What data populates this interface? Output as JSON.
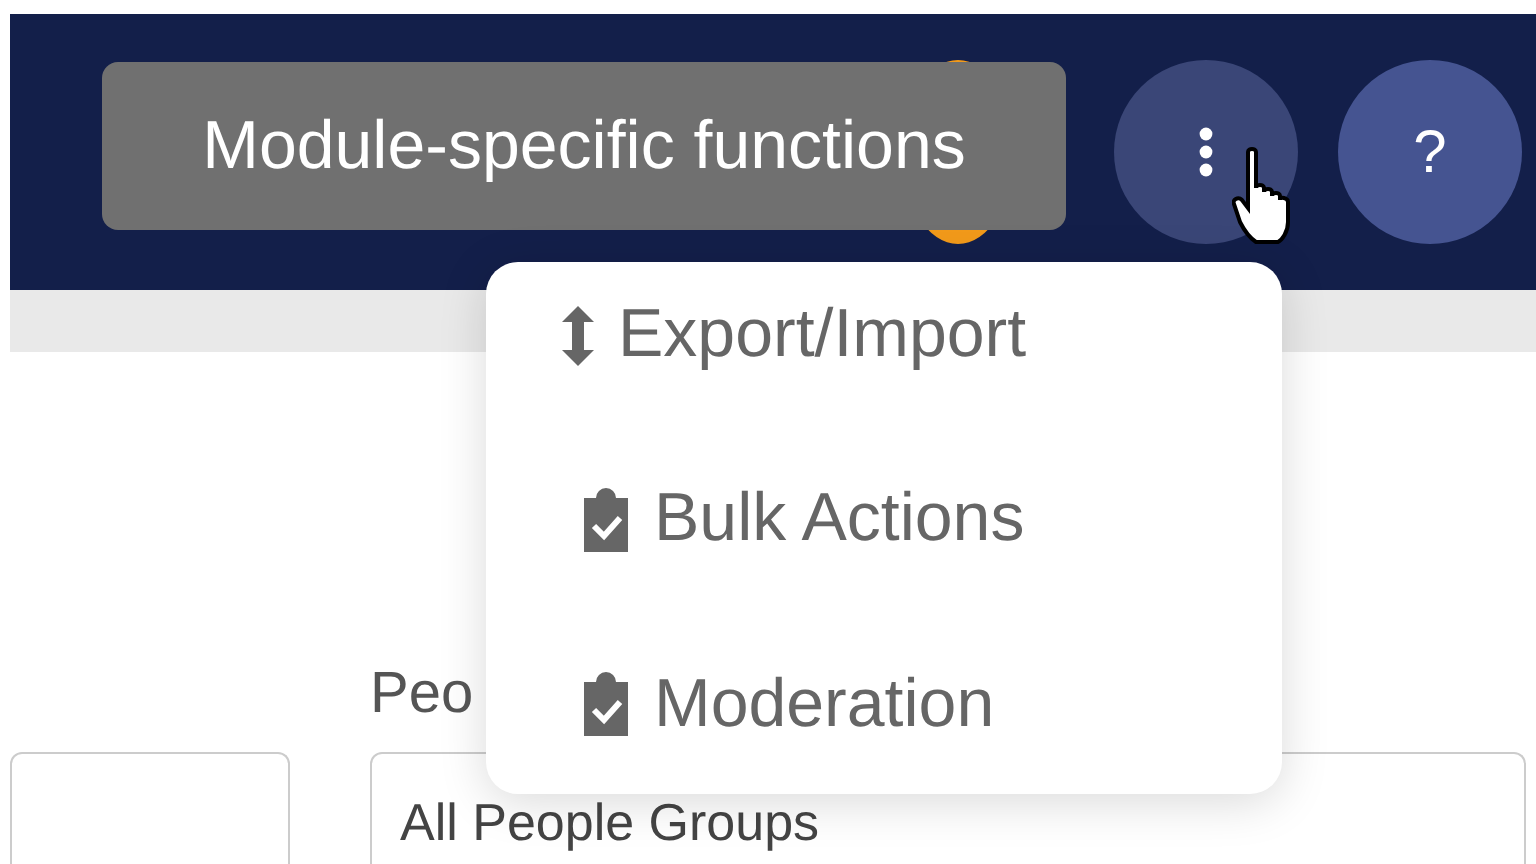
{
  "header": {
    "tooltip": "Module-specific functions",
    "help_button": "?"
  },
  "menu": {
    "items": [
      {
        "label": "Export/Import",
        "kind": "arrows"
      },
      {
        "label": "Bulk Actions",
        "kind": "clipboard"
      },
      {
        "label": "Moderation",
        "kind": "clipboard"
      }
    ]
  },
  "filters": {
    "people_field": {
      "label": "Peo",
      "value": "All People Groups"
    }
  }
}
